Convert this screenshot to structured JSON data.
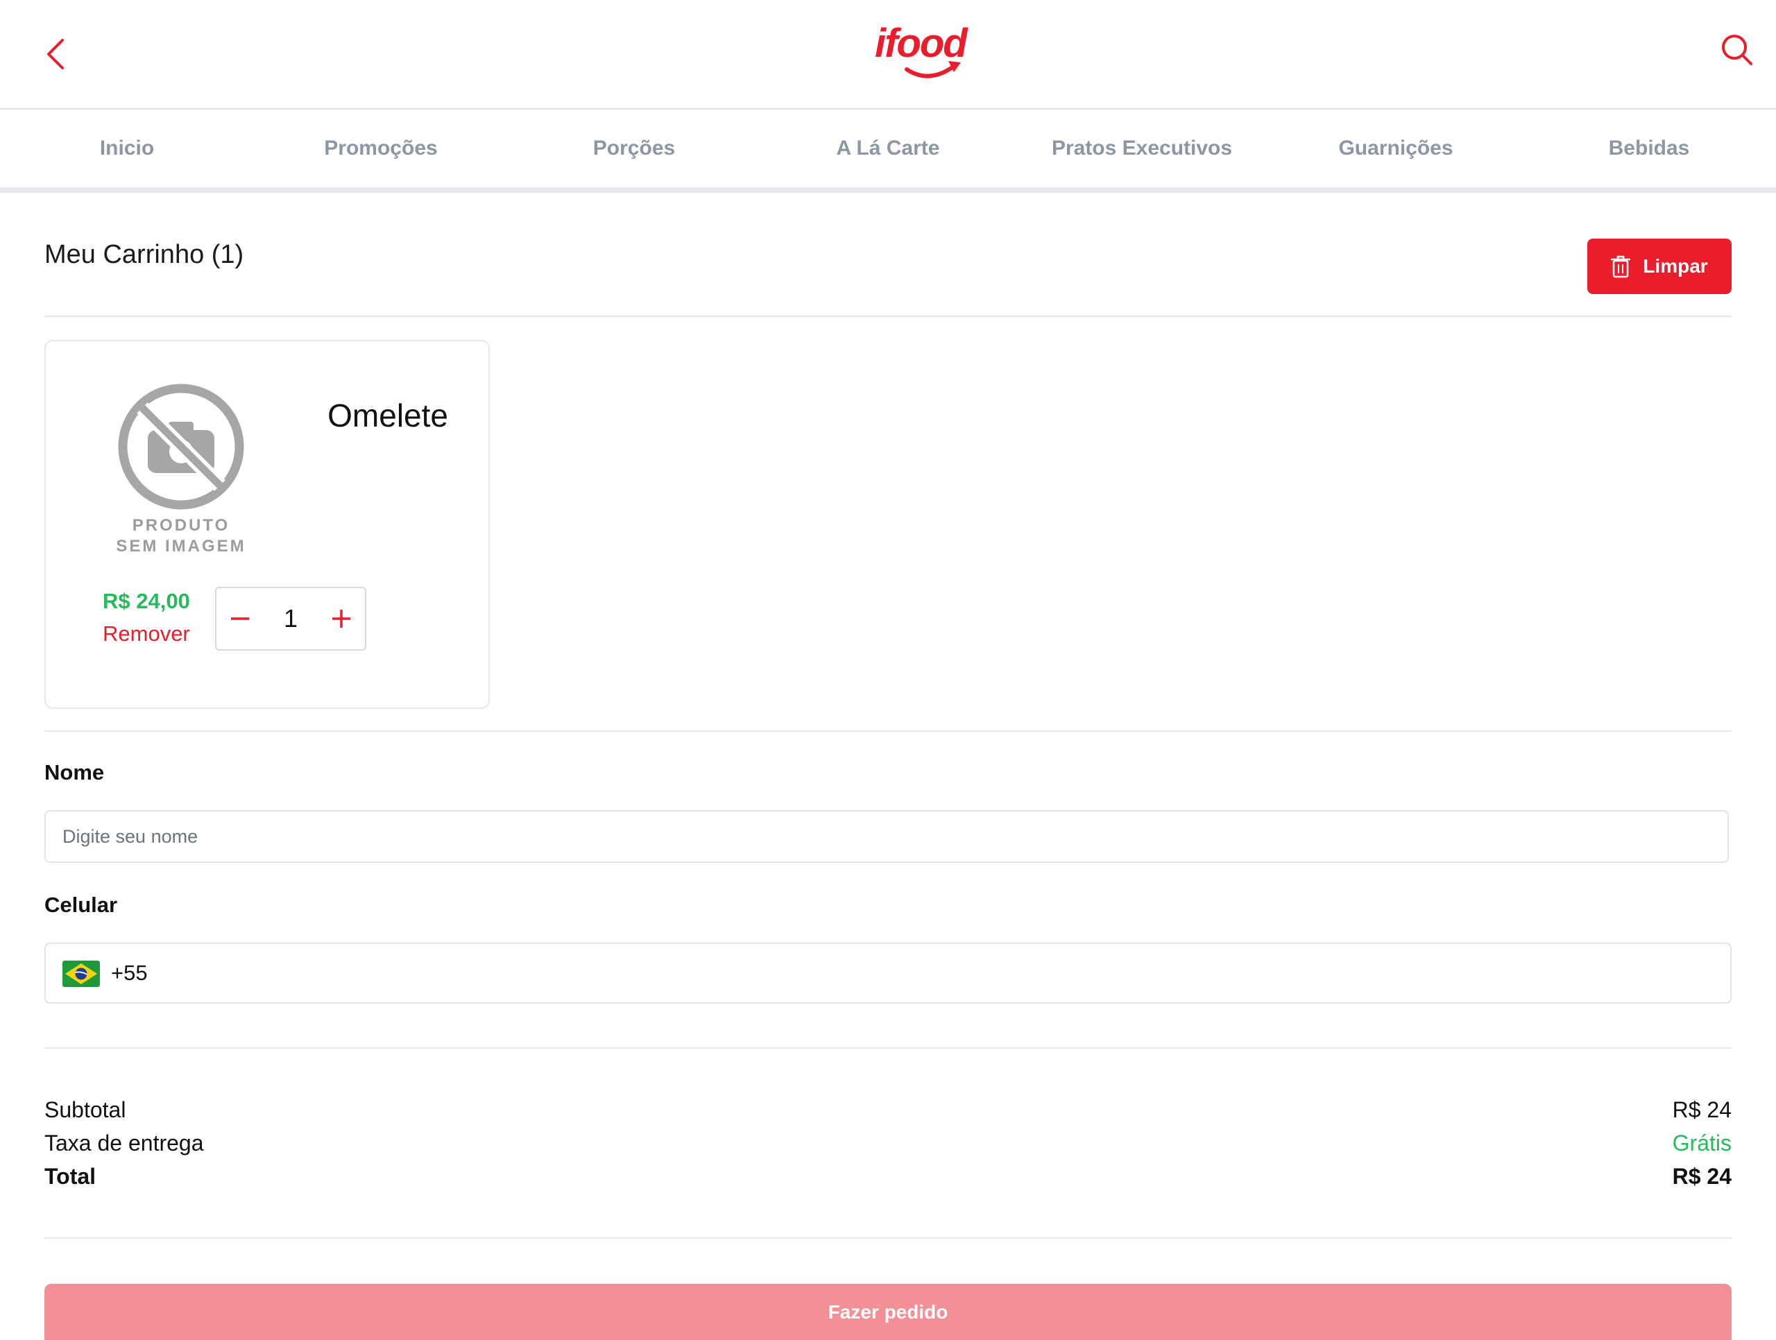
{
  "header": {
    "logo_text": "ifood",
    "back_icon": "chevron-left-icon",
    "search_icon": "search-icon"
  },
  "tabs": [
    {
      "label": "Inicio"
    },
    {
      "label": "Promoções"
    },
    {
      "label": "Porções"
    },
    {
      "label": "A Lá Carte"
    },
    {
      "label": "Pratos Executivos"
    },
    {
      "label": "Guarnições"
    },
    {
      "label": "Bebidas"
    }
  ],
  "cart": {
    "title": "Meu Carrinho (1)",
    "clear_label": "Limpar",
    "clear_icon": "trash-icon"
  },
  "item": {
    "name": "Omelete",
    "image_placeholder_line1": "PRODUTO",
    "image_placeholder_line2": "SEM IMAGEM",
    "price": "R$ 24,00",
    "remove_label": "Remover",
    "quantity": "1"
  },
  "form": {
    "name_label": "Nome",
    "name_placeholder": "Digite seu nome",
    "phone_label": "Celular",
    "phone_country_code": "+55",
    "phone_flag": "brazil-flag-icon"
  },
  "summary": {
    "subtotal_label": "Subtotal",
    "subtotal_value": "R$ 24",
    "delivery_label": "Taxa de entrega",
    "delivery_value": "Grátis",
    "total_label": "Total",
    "total_value": "R$ 24"
  },
  "submit_label": "Fazer pedido",
  "colors": {
    "brand_red": "#ea1d2c",
    "price_green": "#27ba5c",
    "disabled_button": "#f38f96",
    "tab_text": "#8d96a5"
  }
}
